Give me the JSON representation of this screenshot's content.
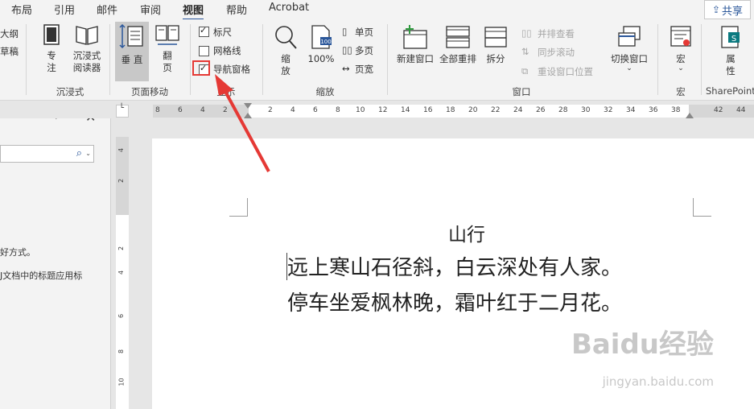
{
  "menubar": {
    "tabs": [
      "布局",
      "引用",
      "邮件",
      "审阅",
      "视图",
      "帮助",
      "Acrobat"
    ],
    "active_index": 4,
    "share_label": "共享"
  },
  "ribbon": {
    "views": {
      "outline": "大纲",
      "draft": "草稿"
    },
    "immersive": {
      "focus": "专\n注",
      "reader": "沉浸式\n阅读器",
      "group_label": "沉浸式"
    },
    "page_movement": {
      "vertical": "垂\n直",
      "flip": "翻\n页",
      "group_label": "页面移动"
    },
    "show": {
      "ruler": "标尺",
      "ruler_checked": true,
      "gridlines": "网格线",
      "gridlines_checked": false,
      "nav_pane": "导航窗格",
      "nav_pane_checked": true,
      "group_label": "显示"
    },
    "zoom": {
      "zoom": "缩\n放",
      "percent": "100%",
      "one_page": "单页",
      "multi_page": "多页",
      "page_width": "页宽",
      "group_label": "缩放"
    },
    "window": {
      "new_window": "新建窗口",
      "arrange_all": "全部重排",
      "split": "拆分",
      "side_by_side": "并排查看",
      "sync_scroll": "同步滚动",
      "reset_position": "重设窗口位置",
      "switch_window": "切换窗口",
      "group_label": "窗口"
    },
    "macros": {
      "label": "宏",
      "group_label": "宏"
    },
    "sharepoint": {
      "properties": "属\n性",
      "group_label": "SharePoint"
    }
  },
  "ruler": {
    "ticks": [
      "8",
      "6",
      "4",
      "2",
      "2",
      "4",
      "6",
      "8",
      "10",
      "12",
      "14",
      "16",
      "18",
      "20",
      "22",
      "24",
      "26",
      "28",
      "30",
      "32",
      "34",
      "36",
      "38",
      "42",
      "44"
    ],
    "vticks": [
      "4",
      "2",
      "2",
      "4",
      "6",
      "8",
      "10"
    ]
  },
  "nav_pane": {
    "partial_text_1": "好方式。",
    "partial_text_2": "J文档中的标题应用标"
  },
  "document": {
    "title": "山行",
    "line1": "远上寒山石径斜，白云深处有人家。",
    "line2": "停车坐爱枫林晚，霜叶红于二月花。"
  },
  "watermark": {
    "main": "Baidu经验",
    "sub": "jingyan.baidu.com"
  },
  "colors": {
    "accent": "#2b579a",
    "annotation_red": "#e53935"
  }
}
